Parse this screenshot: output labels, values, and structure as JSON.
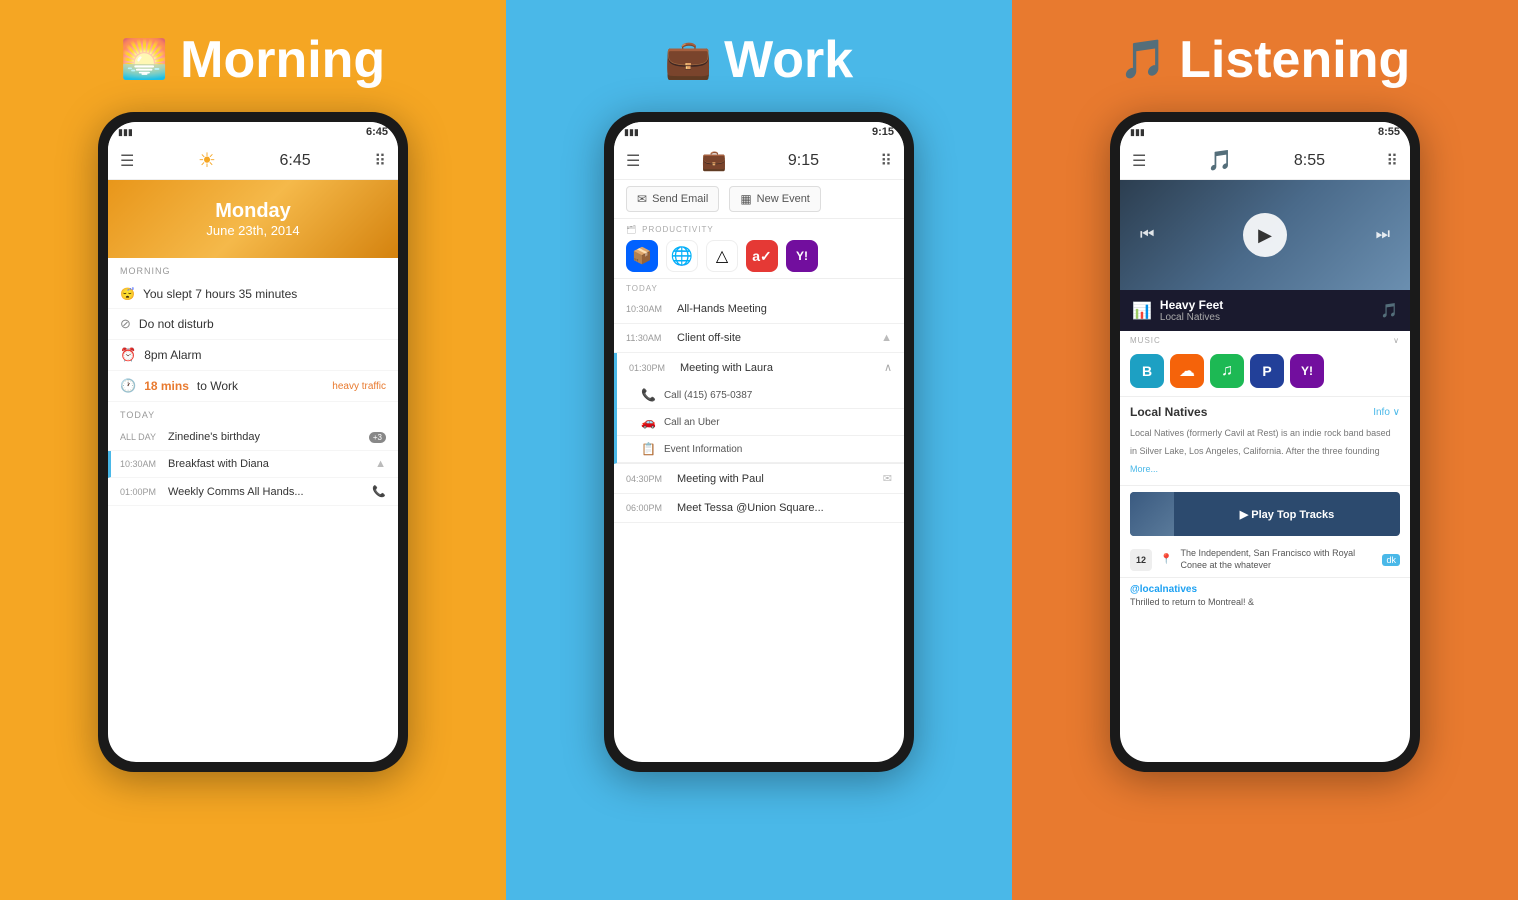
{
  "morning": {
    "title": "Morning",
    "status_time": "6:45",
    "hero": {
      "day": "Monday",
      "date": "June 23th, 2014"
    },
    "morning_section": "MORNING",
    "items": [
      {
        "type": "sleep",
        "text": "You slept 7 hours 35 minutes"
      },
      {
        "type": "dnd",
        "icon": "⊘",
        "text": "Do not disturb"
      },
      {
        "type": "alarm",
        "icon": "⏰",
        "text": "8pm Alarm"
      },
      {
        "type": "traffic",
        "icon": "🕐",
        "mins": "18 mins",
        "text": " to Work",
        "traffic": "heavy traffic"
      }
    ],
    "today_section": "TODAY",
    "today_items": [
      {
        "time": "ALL DAY",
        "title": "Zinedine's birthday",
        "badge": "+3"
      },
      {
        "time": "10:30AM",
        "title": "Breakfast with Diana",
        "nav": true
      },
      {
        "time": "01:00PM",
        "title": "Weekly Comms All Hands...",
        "phone": true
      }
    ]
  },
  "work": {
    "title": "Work",
    "status_time": "9:15",
    "tabs": [
      {
        "icon": "✉",
        "label": "Send Email"
      },
      {
        "icon": "▦",
        "label": "New Event"
      }
    ],
    "productivity_label": "PRODUCTIVITY",
    "apps": [
      {
        "name": "Dropbox",
        "class": "app-dropbox",
        "symbol": "📦"
      },
      {
        "name": "Chrome",
        "class": "app-chrome",
        "symbol": "🌐"
      },
      {
        "name": "Google Drive",
        "class": "app-drive",
        "symbol": "△"
      },
      {
        "name": "Any.do",
        "class": "app-anydo",
        "symbol": "✓"
      },
      {
        "name": "Yahoo",
        "class": "app-yahoo",
        "symbol": "Y!"
      }
    ],
    "today_label": "TODAY",
    "events": [
      {
        "time": "10:30AM",
        "title": "All-Hands Meeting"
      },
      {
        "time": "11:30AM",
        "title": "Client off-site",
        "nav": true
      },
      {
        "time": "01:30PM",
        "title": "Meeting with Laura",
        "expanded": true,
        "sub_items": [
          {
            "icon": "📞",
            "text": "Call (415) 675-0387"
          },
          {
            "icon": "🚗",
            "text": "Call an Uber"
          },
          {
            "icon": "📋",
            "text": "Event Information"
          }
        ]
      },
      {
        "time": "04:30PM",
        "title": "Meeting with Paul",
        "email": true
      },
      {
        "time": "06:00PM",
        "title": "Meet Tessa @Union Square..."
      }
    ]
  },
  "listening": {
    "title": "Listening",
    "status_time": "8:55",
    "now_playing": {
      "track": "Heavy Feet",
      "artist": "Local Natives"
    },
    "music_section": "MUSIC",
    "music_apps": [
      {
        "name": "Bandcamp",
        "class": "app-bandcamp",
        "symbol": "B"
      },
      {
        "name": "SoundCloud",
        "class": "app-soundcloud",
        "symbol": "☁"
      },
      {
        "name": "Spotify",
        "class": "app-spotify",
        "symbol": "♫"
      },
      {
        "name": "Pandora",
        "class": "app-pandora",
        "symbol": "P"
      },
      {
        "name": "Yahoo Music",
        "class": "app-yahoo-music",
        "symbol": "Y!"
      }
    ],
    "artist": {
      "name": "Local Natives",
      "info_label": "Info ∨",
      "description": "Local Natives (formerly Cavil at Rest) is an indie rock band based in Silver Lake, Los Angeles, California. After the three founding",
      "more": "More..."
    },
    "play_top_tracks": "▶  Play Top Tracks",
    "event": {
      "date": "12",
      "venue": "The Independent, San Francisco",
      "detail": "with Royal Conee at the whatever",
      "badge": "dk"
    },
    "twitter": {
      "handle": "@localnatives",
      "text": "Thrilled to return to Montreal! &"
    }
  }
}
